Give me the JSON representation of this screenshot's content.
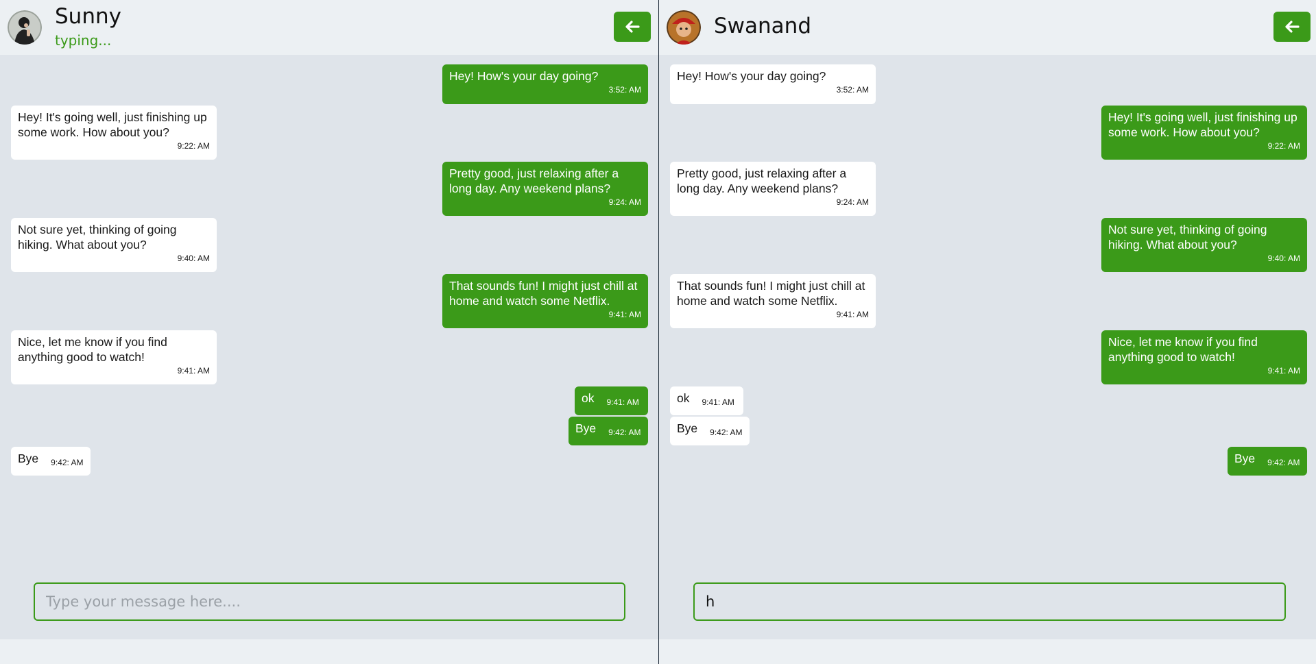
{
  "left_panel": {
    "contact_name": "Sunny",
    "status": "typing...",
    "input_value": "",
    "input_placeholder": "Type your message here...."
  },
  "right_panel": {
    "contact_name": "Swanand",
    "input_value": "h",
    "input_placeholder": "Type your message here...."
  },
  "messages": [
    {
      "text": "Hey! How's your day going?",
      "time": "3:52: AM",
      "sender": "swanand"
    },
    {
      "text": "Hey! It's going well, just finishing up some work. How about you?",
      "time": "9:22: AM",
      "sender": "sunny"
    },
    {
      "text": "Pretty good, just relaxing after a long day. Any weekend plans?",
      "time": "9:24: AM",
      "sender": "swanand"
    },
    {
      "text": "Not sure yet, thinking of going hiking. What about you?",
      "time": "9:40: AM",
      "sender": "sunny"
    },
    {
      "text": "That sounds fun! I might just chill at home and watch some Netflix.",
      "time": "9:41: AM",
      "sender": "swanand"
    },
    {
      "text": "Nice, let me know if you find anything good to watch!",
      "time": "9:41: AM",
      "sender": "sunny"
    },
    {
      "text": "ok",
      "time": "9:41: AM",
      "sender": "swanand"
    },
    {
      "text": "Bye",
      "time": "9:42: AM",
      "sender": "swanand"
    },
    {
      "text": "Bye",
      "time": "9:42: AM",
      "sender": "sunny"
    }
  ],
  "colors": {
    "accent": "#3b9a19",
    "background": "#dfe4ea",
    "header": "#ecf0f3"
  },
  "icons": {
    "back": "arrow-left-icon"
  }
}
